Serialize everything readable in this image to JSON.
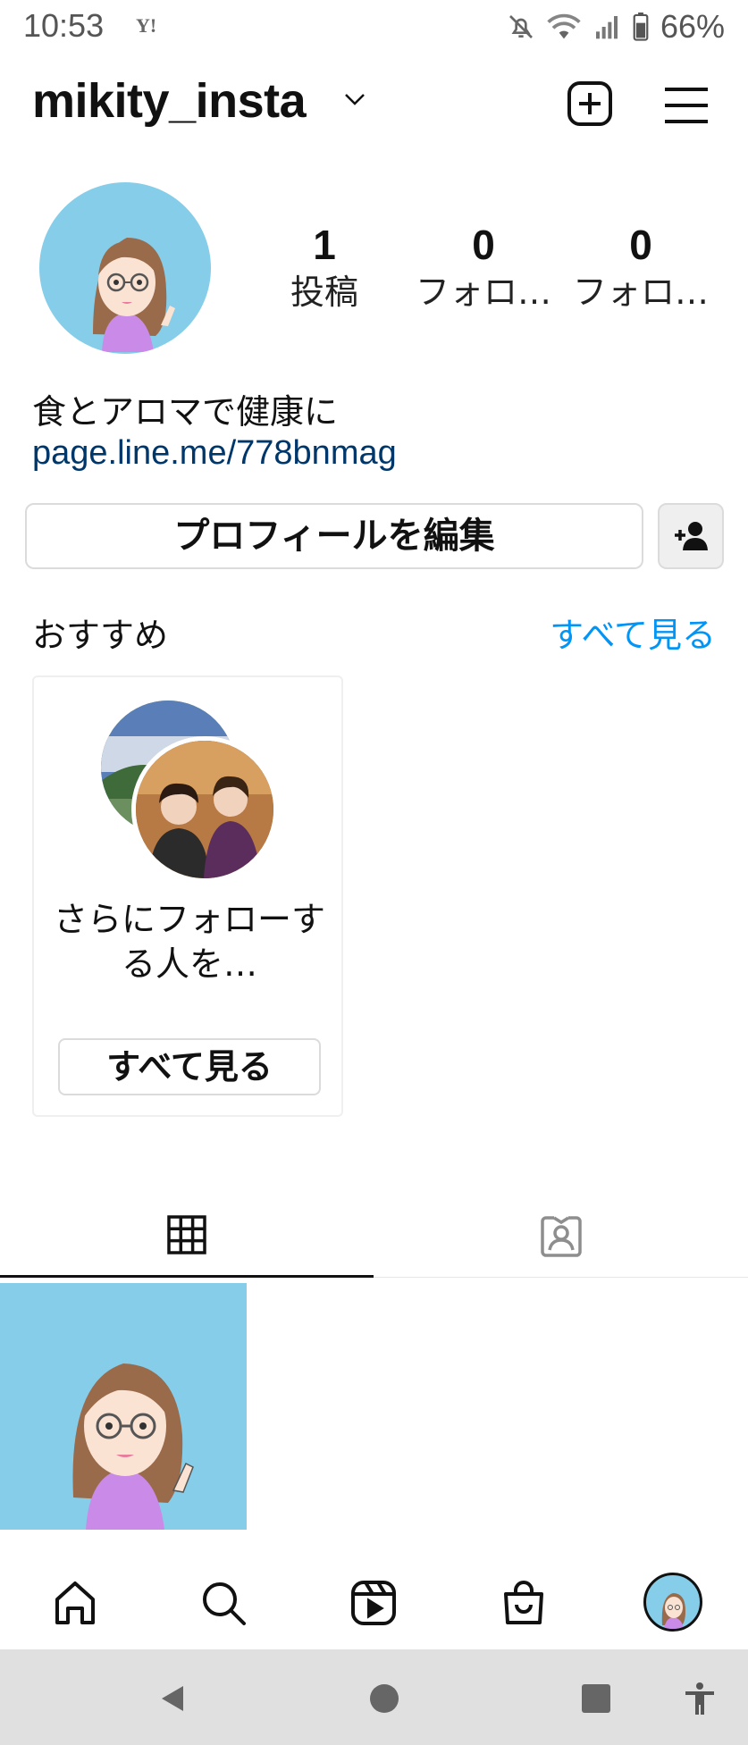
{
  "status_bar": {
    "time": "10:53",
    "carrier_icon_text": "Y!",
    "battery": "66%"
  },
  "header": {
    "username": "mikity_insta"
  },
  "profile": {
    "stats": [
      {
        "count": "1",
        "label": "投稿"
      },
      {
        "count": "0",
        "label": "フォロ…"
      },
      {
        "count": "0",
        "label": "フォロ…"
      }
    ],
    "bio_name": "食とアロマで健康に",
    "bio_link": "page.line.me/778bnmag",
    "edit_profile_label": "プロフィールを編集"
  },
  "suggestions": {
    "title": "おすすめ",
    "see_all": "すべて見る",
    "card": {
      "text": "さらにフォローする人を…",
      "button": "すべて見る"
    }
  },
  "tabs": [
    "grid-icon",
    "tagged-icon"
  ],
  "bottom_nav": [
    "home-icon",
    "search-icon",
    "reels-icon",
    "shop-icon",
    "profile-avatar"
  ],
  "colors": {
    "link": "#00376b",
    "accent_blue": "#0095f6",
    "avatar_bg": "#86cde9"
  }
}
